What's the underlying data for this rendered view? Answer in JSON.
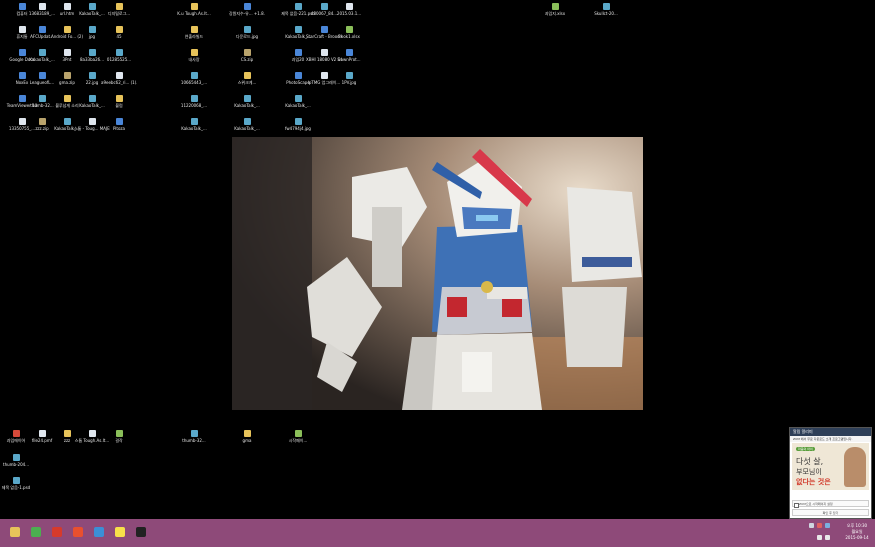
{
  "desktop_icons": [
    {
      "label": "컴퓨터",
      "icon": "computer-icon",
      "kind": "app"
    },
    {
      "label": "휴지통",
      "icon": "recycle-bin-icon",
      "kind": "file"
    },
    {
      "label": "Google Docs",
      "icon": "docs-icon",
      "kind": "app"
    },
    {
      "label": "NoxEx",
      "icon": "app-icon",
      "kind": "app"
    },
    {
      "label": "TeamViewer 10",
      "icon": "teamviewer-icon",
      "kind": "app"
    },
    {
      "label": "13350755_...",
      "icon": "file-icon",
      "kind": "file"
    },
    {
      "label": "13683189_...",
      "icon": "file-icon",
      "kind": "file"
    },
    {
      "label": "AFCUpdat...",
      "icon": "app-icon",
      "kind": "app"
    },
    {
      "label": "KakaoTalk_...",
      "icon": "image-icon",
      "kind": "img"
    },
    {
      "label": "LeagueofL...",
      "icon": "game-icon",
      "kind": "app"
    },
    {
      "label": "thumb-32...",
      "icon": "image-icon",
      "kind": "img"
    },
    {
      "label": "zzz.zip",
      "icon": "zip-icon",
      "kind": "zip"
    },
    {
      "label": "url.htm",
      "icon": "web-icon",
      "kind": "file"
    },
    {
      "label": "Android Fo... (2)",
      "icon": "folder-icon",
      "kind": "folder"
    },
    {
      "label": "3Pnt",
      "icon": "file-icon",
      "kind": "file"
    },
    {
      "label": "gma.zip",
      "icon": "zip-icon",
      "kind": "zip"
    },
    {
      "label": "블루넘게 소리",
      "icon": "folder-icon",
      "kind": "folder"
    },
    {
      "label": "KakaoTalk_...",
      "icon": "image-icon",
      "kind": "img"
    },
    {
      "label": "KakaoTalk_...",
      "icon": "image-icon",
      "kind": "img"
    },
    {
      "label": "jpg",
      "icon": "image-icon",
      "kind": "img"
    },
    {
      "label": "8a33ba26...",
      "icon": "image-icon",
      "kind": "img"
    },
    {
      "label": "22.jpg",
      "icon": "image-icon",
      "kind": "img"
    },
    {
      "label": "KakaoTalk_...",
      "icon": "image-icon",
      "kind": "img"
    },
    {
      "label": "스톰 - Toug... MAJESTIC3...",
      "icon": "file-icon",
      "kind": "file"
    },
    {
      "label": "디지털로그...",
      "icon": "folder-icon",
      "kind": "folder"
    },
    {
      "label": "45",
      "icon": "folder-icon",
      "kind": "folder"
    },
    {
      "label": "01285525...",
      "icon": "image-icon",
      "kind": "img"
    },
    {
      "label": "a9eebc62_ri... (1).mkv",
      "icon": "video-icon",
      "kind": "file"
    },
    {
      "label": "블럼",
      "icon": "folder-icon",
      "kind": "folder"
    },
    {
      "label": "Pitoza",
      "icon": "app-icon",
      "kind": "app"
    },
    {
      "label": "K.u Tough.As.It...",
      "icon": "folder-icon",
      "kind": "folder"
    },
    {
      "label": "연출라빌드",
      "icon": "folder-icon",
      "kind": "folder"
    },
    {
      "label": "내사랑",
      "icon": "folder-icon",
      "kind": "folder"
    },
    {
      "label": "10665443_...",
      "icon": "image-icon",
      "kind": "img"
    },
    {
      "label": "11220068_...",
      "icon": "image-icon",
      "kind": "img"
    },
    {
      "label": "KakaoTalk_...",
      "icon": "image-icon",
      "kind": "img"
    },
    {
      "label": "강원지수-유... +1.8.exe",
      "icon": "app-icon",
      "kind": "app"
    },
    {
      "label": "다운로드.jpg",
      "icon": "image-icon",
      "kind": "img"
    },
    {
      "label": "CS.zip",
      "icon": "zip-icon",
      "kind": "zip"
    },
    {
      "label": "스위크게...",
      "icon": "folder-icon",
      "kind": "folder"
    },
    {
      "label": "KakaoTalk_...",
      "icon": "image-icon",
      "kind": "img"
    },
    {
      "label": "KakaoTalk_...",
      "icon": "image-icon",
      "kind": "img"
    },
    {
      "label": "제목 없음-221.psd",
      "icon": "psd-icon",
      "kind": "img"
    },
    {
      "label": "KakaoTalk_...",
      "icon": "image-icon",
      "kind": "img"
    },
    {
      "label": "과임20",
      "icon": "app-icon",
      "kind": "app"
    },
    {
      "label": "PhotoScape",
      "icon": "photoscape-icon",
      "kind": "app"
    },
    {
      "label": "KakaoTalk_...",
      "icon": "image-icon",
      "kind": "img"
    },
    {
      "label": "fw4794j4.jpg",
      "icon": "image-icon",
      "kind": "img"
    },
    {
      "label": "480067_84...",
      "icon": "image-icon",
      "kind": "img"
    },
    {
      "label": "StarCraft - Brood War",
      "icon": "starcraft-icon",
      "kind": "app"
    },
    {
      "label": "XBHI 18080 V2 S POR...",
      "icon": "file-icon",
      "kind": "file"
    },
    {
      "label": "lpTMG 업그레이...",
      "icon": "file-icon",
      "kind": "file"
    },
    {
      "label": "2015.03.1...",
      "icon": "file-icon",
      "kind": "file"
    },
    {
      "label": "Book1.xlsx",
      "icon": "excel-icon",
      "kind": "web"
    },
    {
      "label": "DawnProt...",
      "icon": "app-icon",
      "kind": "app"
    },
    {
      "label": "1PV.jpg",
      "icon": "image-icon",
      "kind": "img"
    },
    {
      "label": "과임지.xlsx",
      "icon": "excel-icon",
      "kind": "web"
    },
    {
      "label": "Skullct-20...",
      "icon": "image-icon",
      "kind": "img"
    },
    {
      "label": "과임에이어",
      "icon": "app-icon",
      "kind": "red"
    },
    {
      "label": "thumb-204...",
      "icon": "image-icon",
      "kind": "img"
    },
    {
      "label": "제목 없음-1.psd",
      "icon": "psd-icon",
      "kind": "img"
    },
    {
      "label": "file24.pmf",
      "icon": "file-icon",
      "kind": "file"
    },
    {
      "label": "zzz",
      "icon": "folder-icon",
      "kind": "folder"
    },
    {
      "label": "스톰 Tough.As.It...",
      "icon": "file-icon",
      "kind": "file"
    },
    {
      "label": "걸작",
      "icon": "app-icon",
      "kind": "web"
    },
    {
      "label": "thumb-32...",
      "icon": "image-icon",
      "kind": "img"
    },
    {
      "label": "gma",
      "icon": "folder-icon",
      "kind": "folder"
    },
    {
      "label": "시작페이...",
      "icon": "web-icon",
      "kind": "web"
    }
  ],
  "widget": {
    "title": "알림 알리미",
    "subtitle": "ZUM 에서 무료 다운로드 소개 프로그램입니다.",
    "ad_tag": "마음의 아이",
    "ad_line1": "다섯 살,",
    "ad_line2": "부모님이",
    "ad_line3": "없다는 것은",
    "checkbox_label": "ZUM으로 시작페이지 설정",
    "button_label": "확인 후 닫기"
  },
  "taskbar": {
    "items": [
      {
        "name": "file-explorer",
        "icon": "folder-icon",
        "color": "#e7c35a"
      },
      {
        "name": "chrome",
        "icon": "chrome-icon",
        "color": "#4caf50"
      },
      {
        "name": "alyac",
        "icon": "shield-icon",
        "color": "#d63a2b"
      },
      {
        "name": "daum-pot-player",
        "icon": "player-icon",
        "color": "#e8502f"
      },
      {
        "name": "internet-explorer",
        "icon": "ie-icon",
        "color": "#3b8fd6"
      },
      {
        "name": "kakaotalk",
        "icon": "chat-icon",
        "color": "#f7e04a"
      },
      {
        "name": "photoscape",
        "icon": "camera-icon",
        "color": "#222222"
      }
    ],
    "clock_time": "오후 10:30",
    "clock_day": "월요일",
    "clock_date": "2015-09-14"
  },
  "colors": {
    "desktop_bg": "#000000",
    "taskbar": "#8e4a79"
  }
}
